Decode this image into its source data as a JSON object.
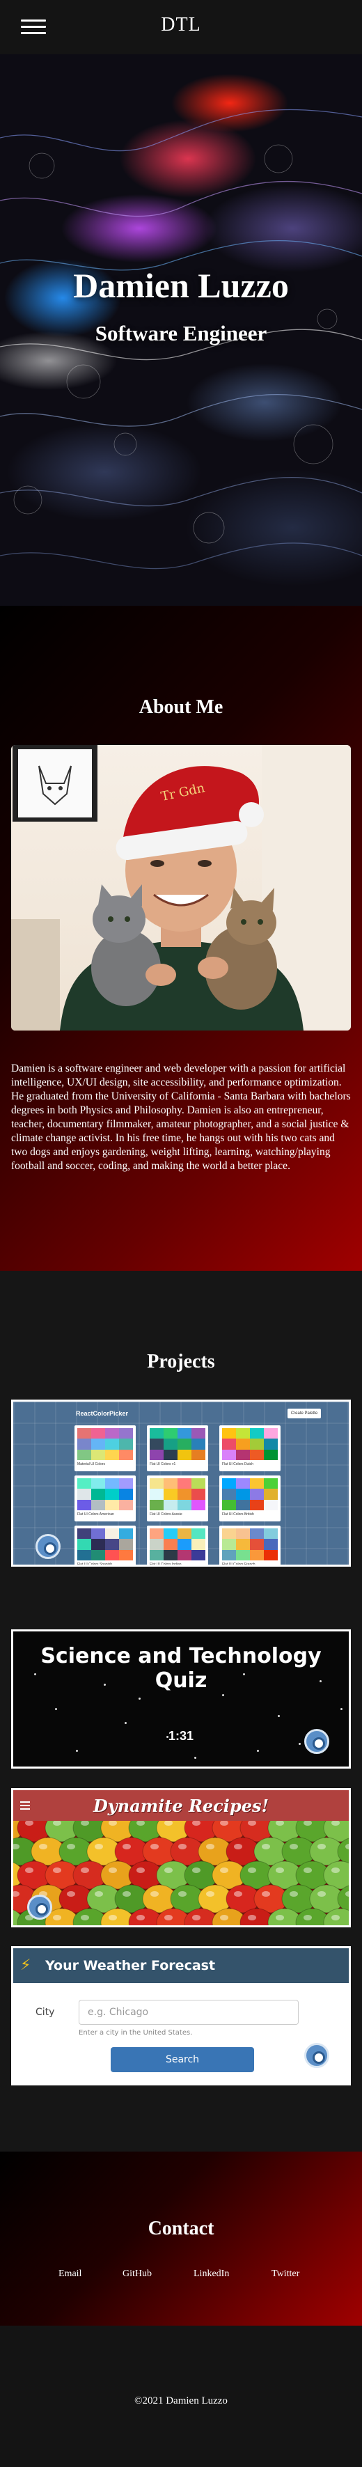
{
  "nav": {
    "brand": "DTL"
  },
  "hero": {
    "name": "Damien Luzzo",
    "role": "Software Engineer"
  },
  "about": {
    "title": "About Me",
    "bio": "Damien is a software engineer and web developer with a passion for artificial intelligence, UX/UI design, site accessibility, and performance optimization. He graduated from the University of California - Santa Barbara with bachelors degrees in both Physics and Philosophy. Damien is also an entrepreneur, teacher, documentary filmmaker, amateur photographer, and a social justice & climate change activist. In his free time, he hangs out with his two cats and two dogs and enjoys gardening, weight lifting, learning, watching/playing football and soccer, coding, and making the world a better place."
  },
  "projects": {
    "title": "Projects",
    "react_color_picker": {
      "title": "ReactColorPicker",
      "button": "Create Palette",
      "palettes": [
        "Material UI Colors",
        "Flat UI Colors v1",
        "Flat UI Colors Dutch",
        "Flat UI Colors American",
        "Flat UI Colors Aussie",
        "Flat UI Colors British",
        "Flat UI Colors Spanish",
        "Flat UI Colors Indian",
        "Flat UI Colors French"
      ]
    },
    "quiz": {
      "title": "Science and Technology Quiz",
      "timer": "1:31"
    },
    "recipes": {
      "title": "Dynamite Recipes!"
    },
    "weather": {
      "title": "Your Weather Forecast",
      "city_label": "City",
      "city_placeholder": "e.g. Chicago",
      "help_text": "Enter a city in the United States.",
      "search_button": "Search"
    }
  },
  "contact": {
    "title": "Contact",
    "links": [
      "Email",
      "GitHub",
      "LinkedIn",
      "Twitter"
    ]
  },
  "footer": {
    "copyright": "©2021 Damien Luzzo"
  },
  "colors": {
    "nav_bg": "#141414",
    "accent_red": "#a00000",
    "recipe_red": "#b0413e",
    "weather_blue": "#34536b",
    "search_blue": "#3975b5"
  }
}
